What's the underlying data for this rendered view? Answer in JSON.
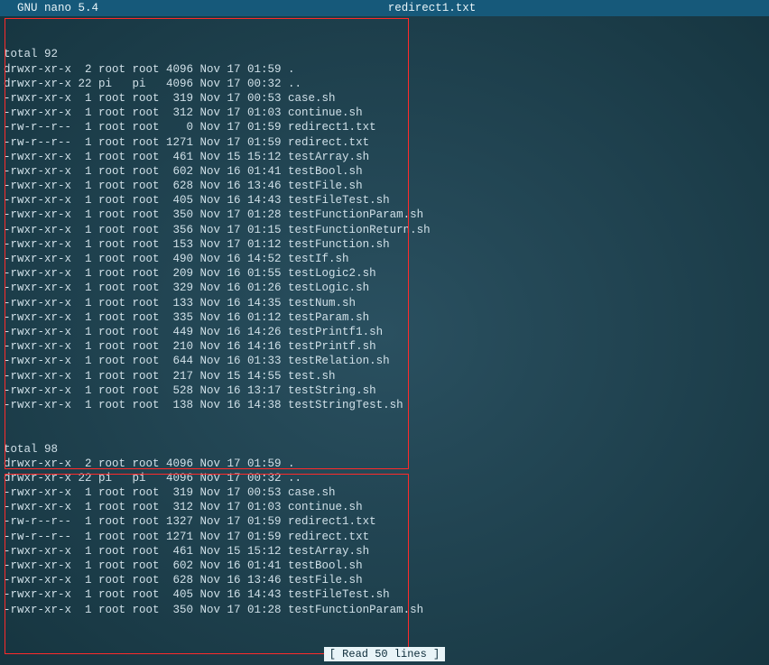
{
  "header": {
    "app_name": "  GNU nano 5.4",
    "filename": "redirect1.txt"
  },
  "listing1": {
    "total": "total 92",
    "rows": [
      {
        "perm": "drwxr-xr-x",
        "links": " 2",
        "owner": "root",
        "group": "root",
        "size": "4096",
        "date": "Nov 17 01:59",
        "name": "."
      },
      {
        "perm": "drwxr-xr-x",
        "links": "22",
        "owner": "pi  ",
        "group": "pi  ",
        "size": "4096",
        "date": "Nov 17 00:32",
        "name": ".."
      },
      {
        "perm": "-rwxr-xr-x",
        "links": " 1",
        "owner": "root",
        "group": "root",
        "size": " 319",
        "date": "Nov 17 00:53",
        "name": "case.sh"
      },
      {
        "perm": "-rwxr-xr-x",
        "links": " 1",
        "owner": "root",
        "group": "root",
        "size": " 312",
        "date": "Nov 17 01:03",
        "name": "continue.sh"
      },
      {
        "perm": "-rw-r--r--",
        "links": " 1",
        "owner": "root",
        "group": "root",
        "size": "   0",
        "date": "Nov 17 01:59",
        "name": "redirect1.txt"
      },
      {
        "perm": "-rw-r--r--",
        "links": " 1",
        "owner": "root",
        "group": "root",
        "size": "1271",
        "date": "Nov 17 01:59",
        "name": "redirect.txt"
      },
      {
        "perm": "-rwxr-xr-x",
        "links": " 1",
        "owner": "root",
        "group": "root",
        "size": " 461",
        "date": "Nov 15 15:12",
        "name": "testArray.sh"
      },
      {
        "perm": "-rwxr-xr-x",
        "links": " 1",
        "owner": "root",
        "group": "root",
        "size": " 602",
        "date": "Nov 16 01:41",
        "name": "testBool.sh"
      },
      {
        "perm": "-rwxr-xr-x",
        "links": " 1",
        "owner": "root",
        "group": "root",
        "size": " 628",
        "date": "Nov 16 13:46",
        "name": "testFile.sh"
      },
      {
        "perm": "-rwxr-xr-x",
        "links": " 1",
        "owner": "root",
        "group": "root",
        "size": " 405",
        "date": "Nov 16 14:43",
        "name": "testFileTest.sh"
      },
      {
        "perm": "-rwxr-xr-x",
        "links": " 1",
        "owner": "root",
        "group": "root",
        "size": " 350",
        "date": "Nov 17 01:28",
        "name": "testFunctionParam.sh"
      },
      {
        "perm": "-rwxr-xr-x",
        "links": " 1",
        "owner": "root",
        "group": "root",
        "size": " 356",
        "date": "Nov 17 01:15",
        "name": "testFunctionReturn.sh"
      },
      {
        "perm": "-rwxr-xr-x",
        "links": " 1",
        "owner": "root",
        "group": "root",
        "size": " 153",
        "date": "Nov 17 01:12",
        "name": "testFunction.sh"
      },
      {
        "perm": "-rwxr-xr-x",
        "links": " 1",
        "owner": "root",
        "group": "root",
        "size": " 490",
        "date": "Nov 16 14:52",
        "name": "testIf.sh"
      },
      {
        "perm": "-rwxr-xr-x",
        "links": " 1",
        "owner": "root",
        "group": "root",
        "size": " 209",
        "date": "Nov 16 01:55",
        "name": "testLogic2.sh"
      },
      {
        "perm": "-rwxr-xr-x",
        "links": " 1",
        "owner": "root",
        "group": "root",
        "size": " 329",
        "date": "Nov 16 01:26",
        "name": "testLogic.sh"
      },
      {
        "perm": "-rwxr-xr-x",
        "links": " 1",
        "owner": "root",
        "group": "root",
        "size": " 133",
        "date": "Nov 16 14:35",
        "name": "testNum.sh"
      },
      {
        "perm": "-rwxr-xr-x",
        "links": " 1",
        "owner": "root",
        "group": "root",
        "size": " 335",
        "date": "Nov 16 01:12",
        "name": "testParam.sh"
      },
      {
        "perm": "-rwxr-xr-x",
        "links": " 1",
        "owner": "root",
        "group": "root",
        "size": " 449",
        "date": "Nov 16 14:26",
        "name": "testPrintf1.sh"
      },
      {
        "perm": "-rwxr-xr-x",
        "links": " 1",
        "owner": "root",
        "group": "root",
        "size": " 210",
        "date": "Nov 16 14:16",
        "name": "testPrintf.sh"
      },
      {
        "perm": "-rwxr-xr-x",
        "links": " 1",
        "owner": "root",
        "group": "root",
        "size": " 644",
        "date": "Nov 16 01:33",
        "name": "testRelation.sh"
      },
      {
        "perm": "-rwxr-xr-x",
        "links": " 1",
        "owner": "root",
        "group": "root",
        "size": " 217",
        "date": "Nov 15 14:55",
        "name": "test.sh"
      },
      {
        "perm": "-rwxr-xr-x",
        "links": " 1",
        "owner": "root",
        "group": "root",
        "size": " 528",
        "date": "Nov 16 13:17",
        "name": "testString.sh"
      },
      {
        "perm": "-rwxr-xr-x",
        "links": " 1",
        "owner": "root",
        "group": "root",
        "size": " 138",
        "date": "Nov 16 14:38",
        "name": "testStringTest.sh"
      }
    ]
  },
  "listing2": {
    "total": "total 98",
    "rows": [
      {
        "perm": "drwxr-xr-x",
        "links": " 2",
        "owner": "root",
        "group": "root",
        "size": "4096",
        "date": "Nov 17 01:59",
        "name": "."
      },
      {
        "perm": "drwxr-xr-x",
        "links": "22",
        "owner": "pi  ",
        "group": "pi  ",
        "size": "4096",
        "date": "Nov 17 00:32",
        "name": ".."
      },
      {
        "perm": "-rwxr-xr-x",
        "links": " 1",
        "owner": "root",
        "group": "root",
        "size": " 319",
        "date": "Nov 17 00:53",
        "name": "case.sh"
      },
      {
        "perm": "-rwxr-xr-x",
        "links": " 1",
        "owner": "root",
        "group": "root",
        "size": " 312",
        "date": "Nov 17 01:03",
        "name": "continue.sh"
      },
      {
        "perm": "-rw-r--r--",
        "links": " 1",
        "owner": "root",
        "group": "root",
        "size": "1327",
        "date": "Nov 17 01:59",
        "name": "redirect1.txt"
      },
      {
        "perm": "-rw-r--r--",
        "links": " 1",
        "owner": "root",
        "group": "root",
        "size": "1271",
        "date": "Nov 17 01:59",
        "name": "redirect.txt"
      },
      {
        "perm": "-rwxr-xr-x",
        "links": " 1",
        "owner": "root",
        "group": "root",
        "size": " 461",
        "date": "Nov 15 15:12",
        "name": "testArray.sh"
      },
      {
        "perm": "-rwxr-xr-x",
        "links": " 1",
        "owner": "root",
        "group": "root",
        "size": " 602",
        "date": "Nov 16 01:41",
        "name": "testBool.sh"
      },
      {
        "perm": "-rwxr-xr-x",
        "links": " 1",
        "owner": "root",
        "group": "root",
        "size": " 628",
        "date": "Nov 16 13:46",
        "name": "testFile.sh"
      },
      {
        "perm": "-rwxr-xr-x",
        "links": " 1",
        "owner": "root",
        "group": "root",
        "size": " 405",
        "date": "Nov 16 14:43",
        "name": "testFileTest.sh"
      },
      {
        "perm": "-rwxr-xr-x",
        "links": " 1",
        "owner": "root",
        "group": "root",
        "size": " 350",
        "date": "Nov 17 01:28",
        "name": "testFunctionParam.sh"
      }
    ]
  },
  "status": {
    "text": "[ Read 50 lines ]"
  }
}
